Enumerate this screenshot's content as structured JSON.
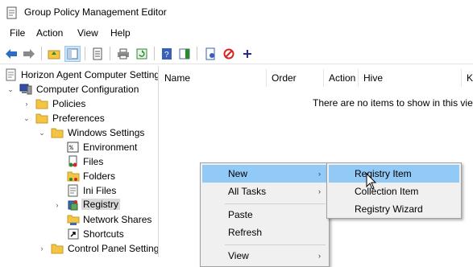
{
  "window": {
    "title": "Group Policy Management Editor"
  },
  "menubar": {
    "items": [
      "File",
      "Action",
      "View",
      "Help"
    ]
  },
  "toolbar": {
    "buttons": [
      "back-arrow-icon",
      "forward-arrow-icon",
      "folder-up-icon",
      "show-hide-tree-icon",
      "properties-icon",
      "print-icon",
      "refresh-icon",
      "help-icon",
      "show-hide-action-pane-icon",
      "new-item-icon",
      "stop-icon",
      "add-icon"
    ]
  },
  "tree": {
    "nodes": [
      {
        "label": "Horizon Agent Computer Setting",
        "icon": "policy-scroll-icon",
        "level": 0
      },
      {
        "label": "Computer Configuration",
        "icon": "computer-icon",
        "level": 1,
        "expanded": true
      },
      {
        "label": "Policies",
        "icon": "folder-icon",
        "level": 2,
        "expanded": false
      },
      {
        "label": "Preferences",
        "icon": "folder-icon",
        "level": 2,
        "expanded": true
      },
      {
        "label": "Windows Settings",
        "icon": "folder-icon",
        "level": 3,
        "expanded": true
      },
      {
        "label": "Environment",
        "icon": "environment-icon",
        "level": 4
      },
      {
        "label": "Files",
        "icon": "files-icon",
        "level": 4
      },
      {
        "label": "Folders",
        "icon": "folders-icon",
        "level": 4
      },
      {
        "label": "Ini Files",
        "icon": "ini-files-icon",
        "level": 4
      },
      {
        "label": "Registry",
        "icon": "registry-icon",
        "level": 4,
        "selected": true
      },
      {
        "label": "Network Shares",
        "icon": "network-shares-icon",
        "level": 4
      },
      {
        "label": "Shortcuts",
        "icon": "shortcuts-icon",
        "level": 4
      },
      {
        "label": "Control Panel Setting",
        "icon": "folder-icon",
        "level": 3,
        "expanded": false
      }
    ]
  },
  "list": {
    "columns": [
      "Name",
      "Order",
      "Action",
      "Hive",
      "K"
    ],
    "empty_message": "There are no items to show in this view"
  },
  "context_menu": {
    "items": [
      {
        "label": "New",
        "submenu": true,
        "highlighted": true
      },
      {
        "label": "All Tasks",
        "submenu": true
      },
      {
        "label": "Paste"
      },
      {
        "label": "Refresh"
      },
      {
        "label": "View",
        "submenu": true
      }
    ]
  },
  "submenu": {
    "items": [
      {
        "label": "Registry Item",
        "highlighted": true
      },
      {
        "label": "Collection Item"
      },
      {
        "label": "Registry Wizard"
      }
    ]
  },
  "colors": {
    "highlight": "#91c9f7",
    "selected_node": "#d9d9d9",
    "folder": "#f4c542"
  }
}
